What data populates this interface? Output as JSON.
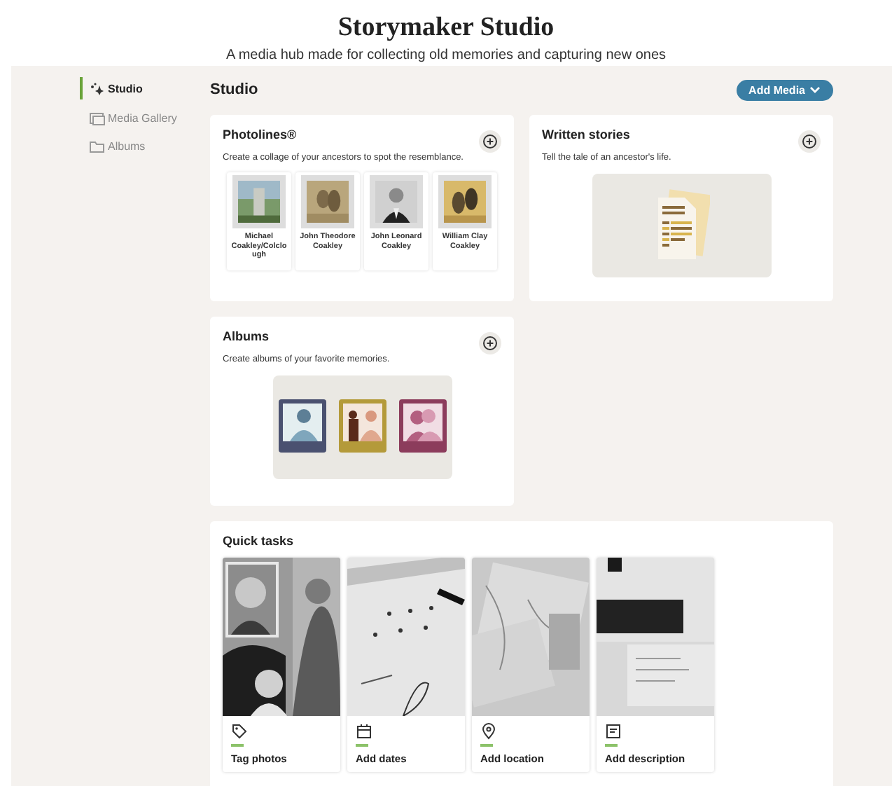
{
  "header": {
    "title": "Storymaker Studio",
    "subtitle": "A media hub made for collecting old memories and capturing new ones"
  },
  "sidebar": {
    "items": [
      {
        "label": "Studio",
        "selected": true
      },
      {
        "label": "Media Gallery",
        "selected": false
      },
      {
        "label": "Albums",
        "selected": false
      }
    ]
  },
  "main": {
    "title": "Studio",
    "add_button": "Add Media"
  },
  "cards": [
    {
      "kind": "photolines",
      "title": "Photolines®",
      "description": "Create a collage of your ancestors to spot the resemblance.",
      "people": [
        {
          "name": "Michael Coakley/Colclough"
        },
        {
          "name": "John Theodore Coakley"
        },
        {
          "name": "John Leonard Coakley"
        },
        {
          "name": "William Clay Coakley"
        }
      ]
    },
    {
      "kind": "stories",
      "title": "Written stories",
      "description": "Tell the tale of an ancestor's life."
    },
    {
      "kind": "albums",
      "title": "Albums",
      "description": "Create albums of your favorite memories."
    }
  ],
  "quick_tasks": {
    "title": "Quick tasks",
    "tasks": [
      {
        "label": "Tag photos"
      },
      {
        "label": "Add dates"
      },
      {
        "label": "Add location"
      },
      {
        "label": "Add description"
      }
    ]
  }
}
